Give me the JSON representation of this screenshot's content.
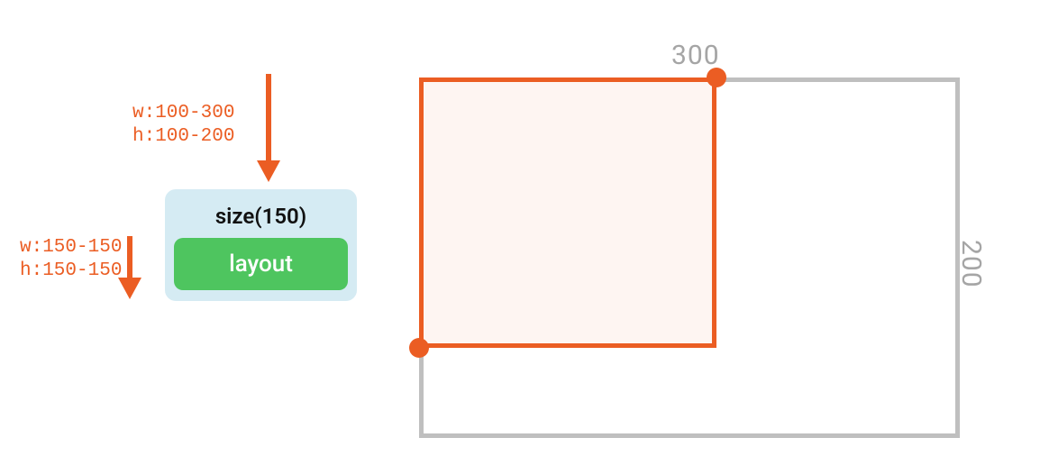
{
  "constraints": {
    "incoming": "w:100-300\nh:100-200",
    "outgoing": "w:150-150\nh:150-150"
  },
  "card": {
    "title": "size(150)",
    "child": "layout"
  },
  "dimensions": {
    "width_label": "300",
    "height_label": "200"
  }
}
